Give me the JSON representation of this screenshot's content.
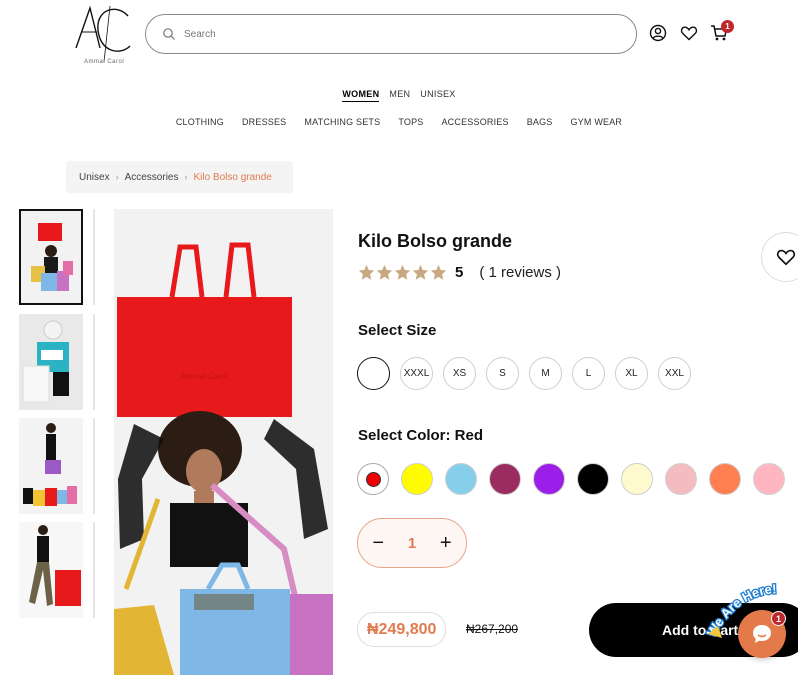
{
  "brand": {
    "logo_letters": "AC",
    "tagline": "Ammal Carol"
  },
  "search": {
    "placeholder": "Search"
  },
  "header": {
    "cart_count": "1"
  },
  "gender_nav": [
    "WOMEN",
    "MEN",
    "UNISEX"
  ],
  "category_nav": [
    "CLOTHING",
    "DRESSES",
    "MATCHING SETS",
    "TOPS",
    "ACCESSORIES",
    "BAGS",
    "GYM WEAR"
  ],
  "breadcrumb": [
    "Unisex",
    "Accessories",
    "Kilo Bolso grande"
  ],
  "product": {
    "title": "Kilo Bolso grande",
    "rating": "5",
    "reviews": "( 1 reviews )",
    "size_label": "Select Size",
    "sizes": [
      "",
      "XXXL",
      "XS",
      "S",
      "M",
      "L",
      "XL",
      "XXL"
    ],
    "color_label": "Select Color: Red",
    "colors": [
      "#e00000",
      "#fffb00",
      "#87ceeb",
      "#9b2c60",
      "#9b1fe8",
      "#000000",
      "#fffacd",
      "#f4bcc0",
      "#ff7f50",
      "#ffb6c1"
    ],
    "quantity": "1",
    "price": "₦249,800",
    "old_price": "₦267,200",
    "add_to_cart": "Add to Cart"
  },
  "chat": {
    "bubble_text": "We Are Here!",
    "badge": "1"
  },
  "colors": {
    "accent": "#e07a4f",
    "badge": "#c0272d",
    "bag_red": "#e8191b"
  }
}
